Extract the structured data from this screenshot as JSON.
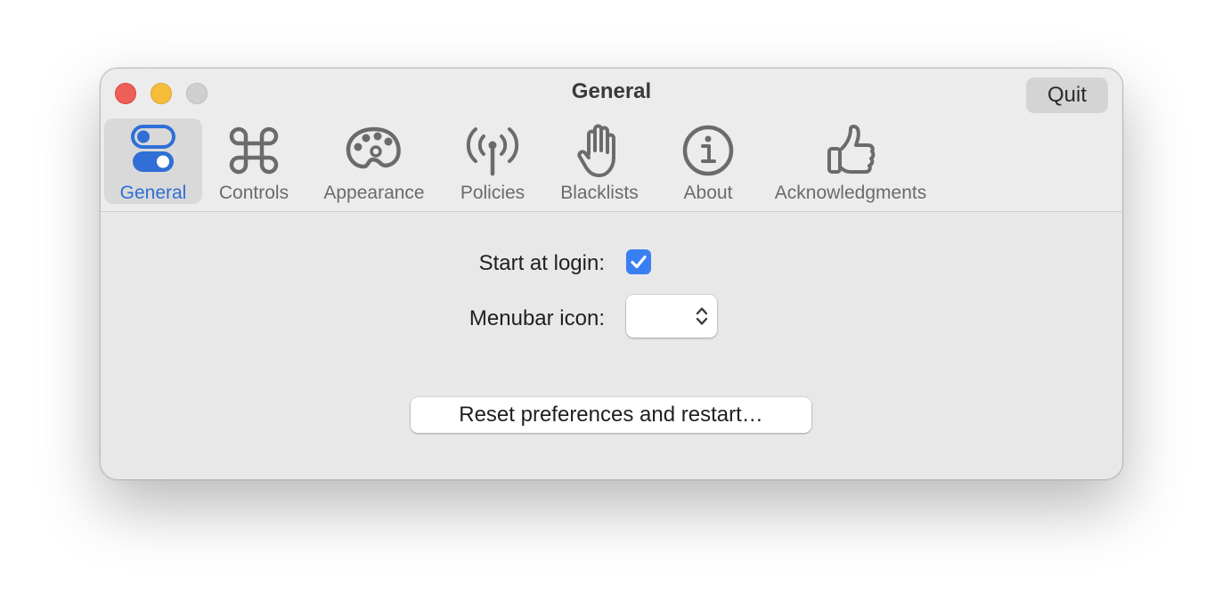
{
  "window": {
    "title": "General",
    "quit_label": "Quit"
  },
  "toolbar": {
    "tabs": [
      {
        "label": "General",
        "icon": "toggle-switches-icon",
        "selected": true
      },
      {
        "label": "Controls",
        "icon": "command-key-icon",
        "selected": false
      },
      {
        "label": "Appearance",
        "icon": "palette-icon",
        "selected": false
      },
      {
        "label": "Policies",
        "icon": "antenna-signal-icon",
        "selected": false
      },
      {
        "label": "Blacklists",
        "icon": "raised-hand-icon",
        "selected": false
      },
      {
        "label": "About",
        "icon": "info-circle-icon",
        "selected": false
      },
      {
        "label": "Acknowledgments",
        "icon": "thumbs-up-icon",
        "selected": false
      }
    ]
  },
  "settings": {
    "start_at_login_label": "Start at login:",
    "start_at_login_checked": true,
    "menubar_icon_label": "Menubar icon:",
    "menubar_icon_value": "",
    "reset_button_label": "Reset preferences and restart…"
  },
  "colors": {
    "accent": "#3a7ff2",
    "selected_tab_text": "#2f6fd6",
    "close": "#ee5f57",
    "minimize": "#f6bd3b",
    "zoom": "#cfcfcf"
  }
}
